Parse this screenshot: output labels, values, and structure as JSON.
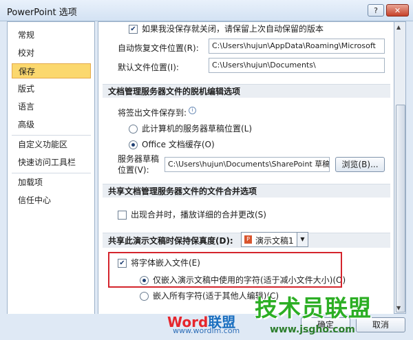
{
  "window": {
    "title": "PowerPoint 选项",
    "help_label": "?",
    "close_label": "✕"
  },
  "sidebar": {
    "items": [
      {
        "label": "常规"
      },
      {
        "label": "校对"
      },
      {
        "label": "保存",
        "active": true
      },
      {
        "label": "版式"
      },
      {
        "label": "语言"
      },
      {
        "label": "高级"
      },
      {
        "label": "自定义功能区"
      },
      {
        "label": "快速访问工具栏"
      },
      {
        "label": "加载项"
      },
      {
        "label": "信任中心"
      }
    ]
  },
  "save": {
    "keep_last_autosave_label": "如果我没保存就关闭，请保留上次自动保留的版本",
    "autorecover_location_label": "自动恢复文件位置(R):",
    "autorecover_location_value": "C:\\Users\\hujun\\AppData\\Roaming\\Microsoft",
    "default_location_label": "默认文件位置(I):",
    "default_location_value": "C:\\Users\\hujun\\Documents\\"
  },
  "offline": {
    "heading": "文档管理服务器文件的脱机编辑选项",
    "save_to_label": "将签出文件保存到:",
    "info_icon": "i",
    "option_server_drafts": "此计算机的服务器草稿位置(L)",
    "option_office_cache": "Office 文档缓存(O)",
    "drafts_location_label_1": "服务器草稿",
    "drafts_location_label_2": "位置(V):",
    "drafts_location_value": "C:\\Users\\hujun\\Documents\\SharePoint 草稿",
    "browse_button": "浏览(B)..."
  },
  "merge": {
    "heading": "共享文档管理服务器文件的文件合并选项",
    "show_details_label": "出现合并时，播放详细的合并更改(S)"
  },
  "fidelity": {
    "heading": "共享此演示文稿时保持保真度(D):",
    "presentation_value": "演示文稿1",
    "dropdown_arrow": "▼",
    "embed_fonts_label": "将字体嵌入文件(E)",
    "embed_used_label": "仅嵌入演示文稿中使用的字符(适于减小文件大小)(O)",
    "embed_all_label": "嵌入所有字符(适于其他人编辑)(C)"
  },
  "footer": {
    "ok_label": "确定",
    "cancel_label": "取消"
  },
  "watermarks": {
    "left_word": "Word",
    "left_cn": "联盟",
    "left_url": "www.wordlm.com",
    "right_text": "技术员联盟",
    "right_url": "www.jsgho.com"
  }
}
